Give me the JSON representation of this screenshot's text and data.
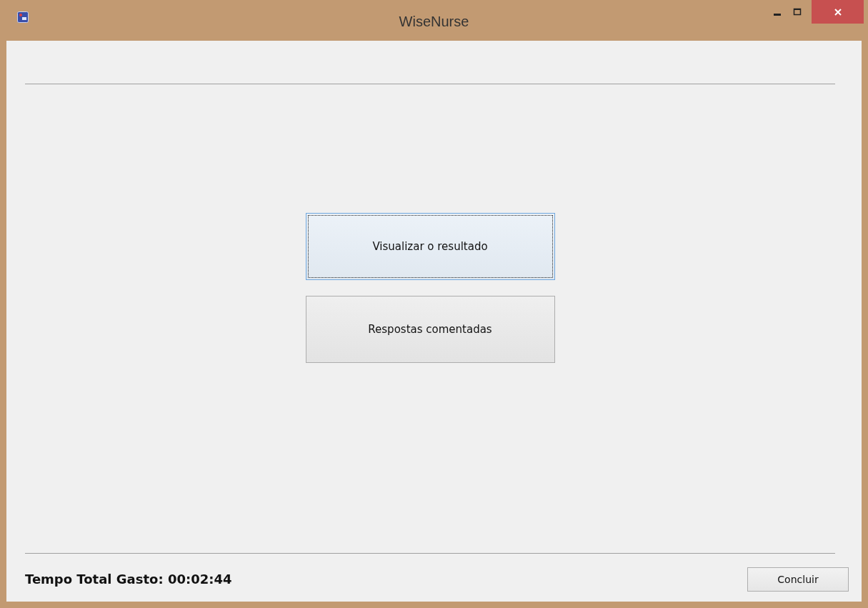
{
  "window": {
    "title": "WiseNurse"
  },
  "actions": [
    {
      "label": "Visualizar o resultado",
      "focused": true
    },
    {
      "label": "Respostas comentadas",
      "focused": false
    }
  ],
  "footer": {
    "elapsed": "Tempo Total Gasto: 00:02:44",
    "finish_button": "Concluir"
  }
}
